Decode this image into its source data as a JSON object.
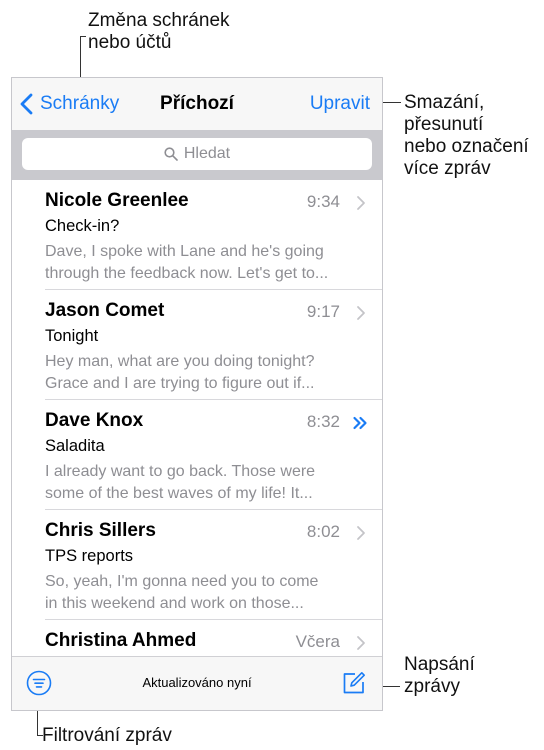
{
  "callouts": {
    "change_mailbox": [
      "Změna schránek",
      "nebo účtů"
    ],
    "edit_desc": [
      "Smazání,",
      "přesunutí",
      "nebo označení",
      "více zpráv"
    ],
    "compose_desc": [
      "Napsání",
      "zprávy"
    ],
    "filter_desc": "Filtrování zpráv"
  },
  "navbar": {
    "back_label": "Schránky",
    "title": "Příchozí",
    "edit_label": "Upravit"
  },
  "search": {
    "placeholder": "Hledat"
  },
  "messages": [
    {
      "sender": "Nicole Greenlee",
      "time": "9:34",
      "subject": "Check-in?",
      "preview": [
        "Dave, I spoke with Lane and he's going",
        "through the feedback now. Let's get to..."
      ],
      "indicator": "chevron-right-icon"
    },
    {
      "sender": "Jason Comet",
      "time": "9:17",
      "subject": "Tonight",
      "preview": [
        "Hey man, what are you doing tonight?",
        "Grace and I are trying to figure out if..."
      ],
      "indicator": "chevron-right-icon"
    },
    {
      "sender": "Dave Knox",
      "time": "8:32",
      "subject": "Saladita",
      "preview": [
        "I already want to go back. Those were",
        "some of the best waves of my life! It..."
      ],
      "indicator": "double-chevron-icon"
    },
    {
      "sender": "Chris Sillers",
      "time": "8:02",
      "subject": "TPS reports",
      "preview": [
        "So, yeah, I'm gonna need you to come",
        "in this weekend and work on those..."
      ],
      "indicator": "chevron-right-icon"
    },
    {
      "sender": "Christina Ahmed",
      "time": "Včera",
      "subject": "",
      "preview": [
        "",
        ""
      ],
      "indicator": "chevron-right-icon"
    }
  ],
  "toolbar": {
    "status": "Aktualizováno nyní"
  },
  "colors": {
    "accent": "#1a7cf5",
    "secondary_text": "#8e8e93",
    "bar_bg": "#f7f7f7",
    "search_bg": "#c9c9ce"
  }
}
